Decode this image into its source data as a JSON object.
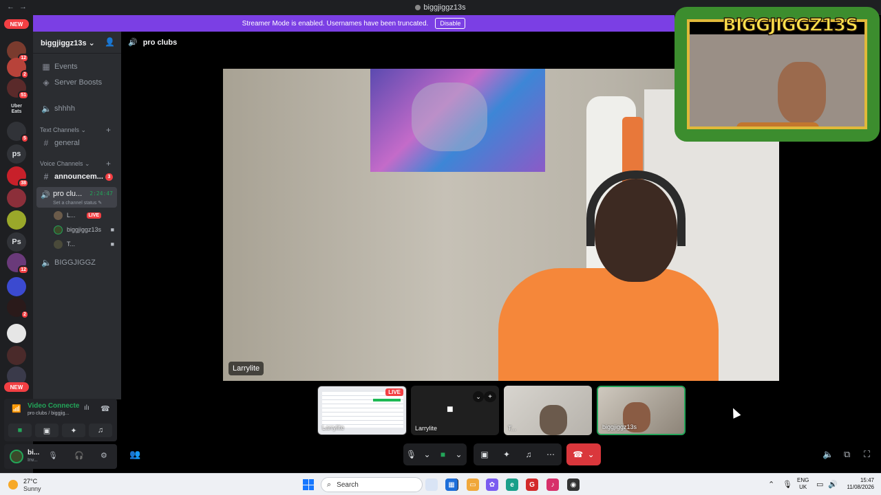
{
  "window": {
    "title": "biggjiggz13s",
    "back": "←",
    "forward": "→"
  },
  "banner": {
    "text": "Streamer Mode is enabled. Usernames have been truncated.",
    "button": "Disable"
  },
  "rail": {
    "new_top": "NEW",
    "new_bottom": "NEW",
    "servers": [
      {
        "badge": "12",
        "color": "#7a3b2e",
        "text": ""
      },
      {
        "badge": "2",
        "color": "#b8433a",
        "text": ""
      },
      {
        "badge": "51",
        "color": "#5a2a2a",
        "text": ""
      },
      {
        "badge": "",
        "color": "#1e1f22",
        "text": "Uber Eats"
      },
      {
        "badge": "5",
        "color": "#313338",
        "text": ""
      },
      {
        "badge": "",
        "color": "#313338",
        "text": "ps"
      },
      {
        "badge": "38",
        "color": "#c8202a",
        "text": ""
      },
      {
        "badge": "",
        "color": "#8c2f3a",
        "text": ""
      },
      {
        "badge": "",
        "color": "#9aa82a",
        "text": ""
      },
      {
        "badge": "",
        "color": "#313338",
        "text": "Ps"
      },
      {
        "badge": "12",
        "color": "#6a3a7a",
        "text": ""
      },
      {
        "badge": "",
        "color": "#3b4ad0",
        "text": ""
      },
      {
        "badge": "2",
        "color": "#2a1a1a",
        "text": ""
      },
      {
        "badge": "",
        "color": "#e6e6e6",
        "text": ""
      },
      {
        "badge": "",
        "color": "#4a2a2a",
        "text": ""
      },
      {
        "badge": "",
        "color": "#3a3a4a",
        "text": ""
      }
    ]
  },
  "sidebar": {
    "server_name": "biggjiggz13s",
    "items": {
      "events": "Events",
      "boosts": "Server Boosts",
      "shhhh": "shhhh",
      "text_channels": "Text Channels",
      "general": "general",
      "voice_channels": "Voice Channels",
      "announcements": "announcem...",
      "announcements_badge": "3",
      "pro_clubs": "pro clu...",
      "pro_clubs_time": "2:24:47",
      "pro_clubs_status": "Set a channel status",
      "biggjiggz": "BIGGJIGGZ"
    },
    "members": [
      {
        "name": "L...",
        "live": "LIVE"
      },
      {
        "name": "biggjiggz13s",
        "live": ""
      },
      {
        "name": "T...",
        "live": ""
      }
    ]
  },
  "voice_panel": {
    "status": "Video Connecte",
    "sub": "pro clubs / biggjig..."
  },
  "userbar": {
    "name": "bi...",
    "status": "Inv..."
  },
  "voice_header": {
    "channel": "pro clubs"
  },
  "main_video": {
    "label": "Larrylite"
  },
  "overlay": {
    "logo_text": "BIGGJIGGZ13S"
  },
  "thumbnails": [
    {
      "label": "Larrylite",
      "live": "LIVE"
    },
    {
      "label": "Larrylite"
    },
    {
      "label": "T..."
    },
    {
      "label": "biggjiggz13s"
    }
  ],
  "taskbar": {
    "temp": "27°C",
    "weather": "Sunny",
    "search": "Search",
    "lang_top": "ENG",
    "lang_bottom": "UK",
    "time": "15:47",
    "date": "11/08/2026"
  }
}
